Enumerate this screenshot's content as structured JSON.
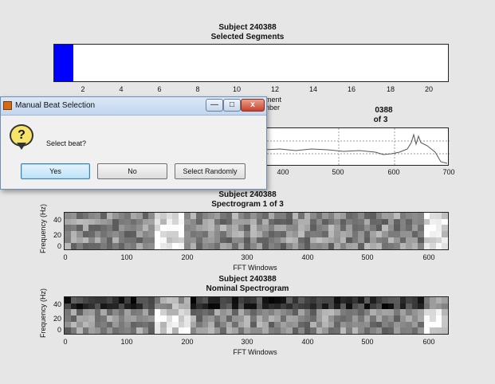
{
  "figure": {
    "top_plot": {
      "title_line1": "Subject 240388",
      "title_line2": "Selected Segments",
      "xticks": [
        "2",
        "4",
        "6",
        "8",
        "10",
        "12",
        "14",
        "16",
        "18",
        "20"
      ],
      "xlabel_partial": "Segment Number",
      "bar_color": "#0000ff",
      "selected_segment": 1
    },
    "beat_plot": {
      "title_line1_partial": "0388",
      "title_line2_partial": "of 3",
      "xticks": [
        "400",
        "500",
        "600",
        "700"
      ]
    },
    "spectrogram1": {
      "title_line1": "Subject 240388",
      "title_line2": "Spectrogram 1 of 3",
      "yticks": [
        "40",
        "20",
        "0"
      ],
      "ylabel": "Frequency (Hz)",
      "xticks": [
        "0",
        "100",
        "200",
        "300",
        "400",
        "500",
        "600"
      ],
      "xlabel": "FFT Windows"
    },
    "spectrogram2": {
      "title_line1": "Subject 240388",
      "title_line2": "Nominal Spectrogram",
      "yticks": [
        "40",
        "20",
        "0"
      ],
      "ylabel": "Frequency (Hz)",
      "xticks": [
        "0",
        "100",
        "200",
        "300",
        "400",
        "500",
        "600"
      ],
      "xlabel": "FFT Windows"
    }
  },
  "dialog": {
    "title": "Manual Beat Selection",
    "prompt": "Select beat?",
    "buttons": {
      "yes": "Yes",
      "no": "No",
      "random": "Select Randomly"
    },
    "window_buttons": {
      "minimize": "—",
      "maximize": "□",
      "close": "x"
    }
  }
}
